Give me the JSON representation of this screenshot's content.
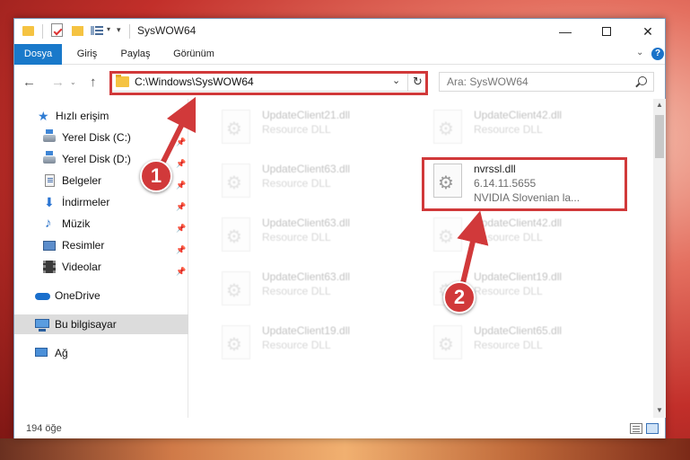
{
  "window": {
    "title": "SysWOW64",
    "quick_access": {
      "arrow": "▾",
      "customize": "▾"
    },
    "controls": {
      "minimize": "—",
      "close": "✕"
    }
  },
  "ribbon": {
    "tabs": [
      {
        "label": "Dosya"
      },
      {
        "label": "Giriş"
      },
      {
        "label": "Paylaş"
      },
      {
        "label": "Görünüm"
      }
    ],
    "expand": "⌄",
    "help": "?"
  },
  "navigation": {
    "back": "←",
    "forward": "→",
    "recent": "⌄",
    "up": "↑",
    "address": "C:\\Windows\\SysWOW64",
    "address_dropdown": "⌄",
    "refresh": "↻",
    "search_placeholder": "Ara: SysWOW64"
  },
  "sidebar": {
    "pin_glyph": "📌",
    "items": [
      {
        "label": "Hızlı erişim",
        "icon": "star-icon"
      },
      {
        "label": "Yerel Disk (C:)",
        "icon": "disk-icon",
        "pinned": true
      },
      {
        "label": "Yerel Disk (D:)",
        "icon": "disk-icon",
        "pinned": true
      },
      {
        "label": "Belgeler",
        "icon": "documents-icon",
        "pinned": true
      },
      {
        "label": "İndirmeler",
        "icon": "downloads-icon",
        "pinned": true
      },
      {
        "label": "Müzik",
        "icon": "music-icon",
        "pinned": true
      },
      {
        "label": "Resimler",
        "icon": "pictures-icon",
        "pinned": true
      },
      {
        "label": "Videolar",
        "icon": "videos-icon",
        "pinned": true
      },
      {
        "label": "OneDrive",
        "icon": "onedrive-icon"
      },
      {
        "label": "Bu bilgisayar",
        "icon": "computer-icon",
        "selected": true
      },
      {
        "label": "Ağ",
        "icon": "network-icon"
      }
    ]
  },
  "files": [
    {
      "name": "UpdateClient21.dll",
      "type": "Resource DLL",
      "faded": true
    },
    {
      "name": "UpdateClient42.dll",
      "type": "Resource DLL",
      "faded": true
    },
    {
      "name": "UpdateClient63.dll",
      "type": "Resource DLL",
      "faded": true
    },
    {
      "name": "nvrssl.dll",
      "version": "6.14.11.5655",
      "description": "NVIDIA Slovenian la...",
      "faded": false
    },
    {
      "name": "UpdateClient63.dll",
      "type": "Resource DLL",
      "faded": true
    },
    {
      "name": "UpdateClient42.dll",
      "type": "Resource DLL",
      "faded": true
    },
    {
      "name": "UpdateClient63.dll",
      "type": "Resource DLL",
      "faded": true
    },
    {
      "name": "UpdateClient19.dll",
      "type": "Resource DLL",
      "faded": true
    },
    {
      "name": "UpdateClient19.dll",
      "type": "Resource DLL",
      "faded": true
    },
    {
      "name": "UpdateClient65.dll",
      "type": "Resource DLL",
      "faded": true
    }
  ],
  "scrollbar": {
    "up": "▲",
    "down": "▼"
  },
  "status": {
    "item_count": "194 öğe"
  },
  "annotations": {
    "step1": "1",
    "step2": "2",
    "highlight_color": "#d1393a"
  }
}
